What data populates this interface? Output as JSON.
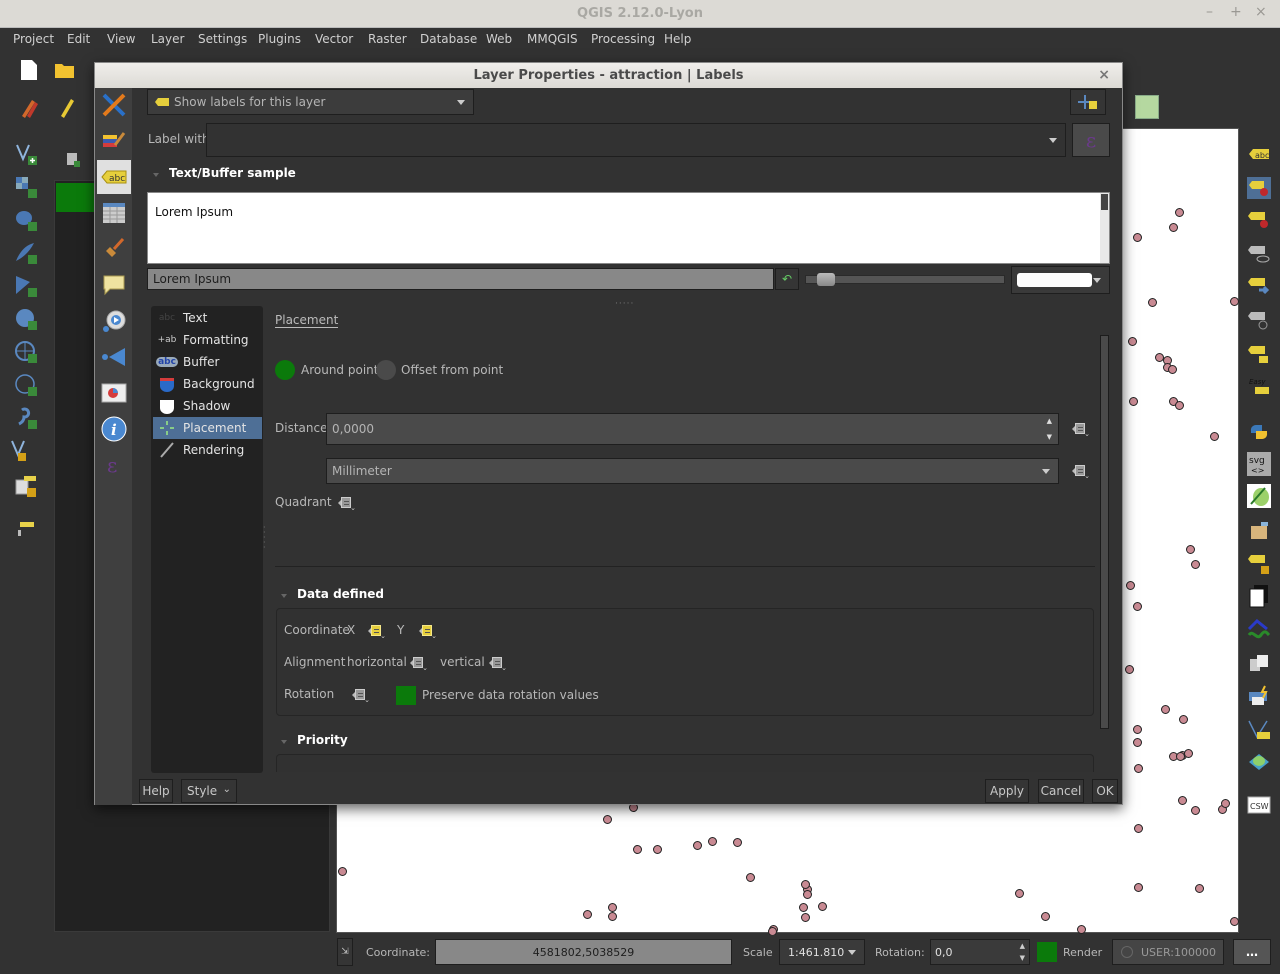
{
  "window": {
    "title": "QGIS 2.12.0-Lyon",
    "controls": [
      "–",
      "+",
      "×"
    ]
  },
  "menubar": [
    "Project",
    "Edit",
    "View",
    "Layer",
    "Settings",
    "Plugins",
    "Vector",
    "Raster",
    "Database",
    "Web",
    "MMQGIS",
    "Processing",
    "Help"
  ],
  "dialog": {
    "title": "Layer Properties - attraction | Labels",
    "close": "×",
    "vertical_tabs": [
      "general",
      "style",
      "labels",
      "fields",
      "rendering",
      "display",
      "actions",
      "joins",
      "diagrams",
      "metadata",
      "variables"
    ],
    "selected_tab": "labels",
    "label_mode": "Show labels for this layer",
    "label_with_label": "Label with",
    "label_with_value": "",
    "expression_button": "ε",
    "sample_section": "Text/Buffer sample",
    "sample_text": "Lorem Ipsum",
    "sample_input": "Lorem Ipsum",
    "sample_zoom_fraction": 0.06,
    "sample_bg_color": "#ffffff",
    "categories": [
      {
        "label": "Text",
        "icon": "abc-text-icon"
      },
      {
        "label": "Formatting",
        "icon": "formatting-icon"
      },
      {
        "label": "Buffer",
        "icon": "buffer-icon"
      },
      {
        "label": "Background",
        "icon": "background-shield-icon"
      },
      {
        "label": "Shadow",
        "icon": "shadow-shield-icon"
      },
      {
        "label": "Placement",
        "icon": "placement-icon"
      },
      {
        "label": "Rendering",
        "icon": "rendering-brush-icon"
      }
    ],
    "selected_category": "Placement",
    "placement": {
      "heading": "Placement",
      "options": [
        "Around point",
        "Offset from point"
      ],
      "selected_option": "Around point",
      "distance_label": "Distance",
      "distance_value": "0,0000",
      "unit_value": "Millimeter",
      "quadrant_label": "Quadrant"
    },
    "data_defined": {
      "heading": "Data defined",
      "coordinate_label": "Coordinate",
      "x_label": "X",
      "y_label": "Y",
      "alignment_label": "Alignment",
      "horizontal_label": "horizontal",
      "vertical_label": "vertical",
      "rotation_label": "Rotation",
      "preserve_label": "Preserve data rotation values",
      "preserve_checked": true
    },
    "priority_heading": "Priority",
    "buttons": {
      "help": "Help",
      "style": "Style",
      "apply": "Apply",
      "cancel": "Cancel",
      "ok": "OK"
    }
  },
  "statusbar": {
    "coordinate_label": "Coordinate:",
    "coordinate_value": "4581802,5038529",
    "scale_label": "Scale",
    "scale_value": "1:461.810",
    "rotation_label": "Rotation:",
    "rotation_value": "0,0",
    "render_label": "Render",
    "render_checked": true,
    "crs_value": "USER:100000",
    "messages_icon": "…"
  },
  "colors": {
    "accent_green": "#0b7a0b",
    "selection_blue": "#4e6f96",
    "point_fill": "#c98a93"
  }
}
